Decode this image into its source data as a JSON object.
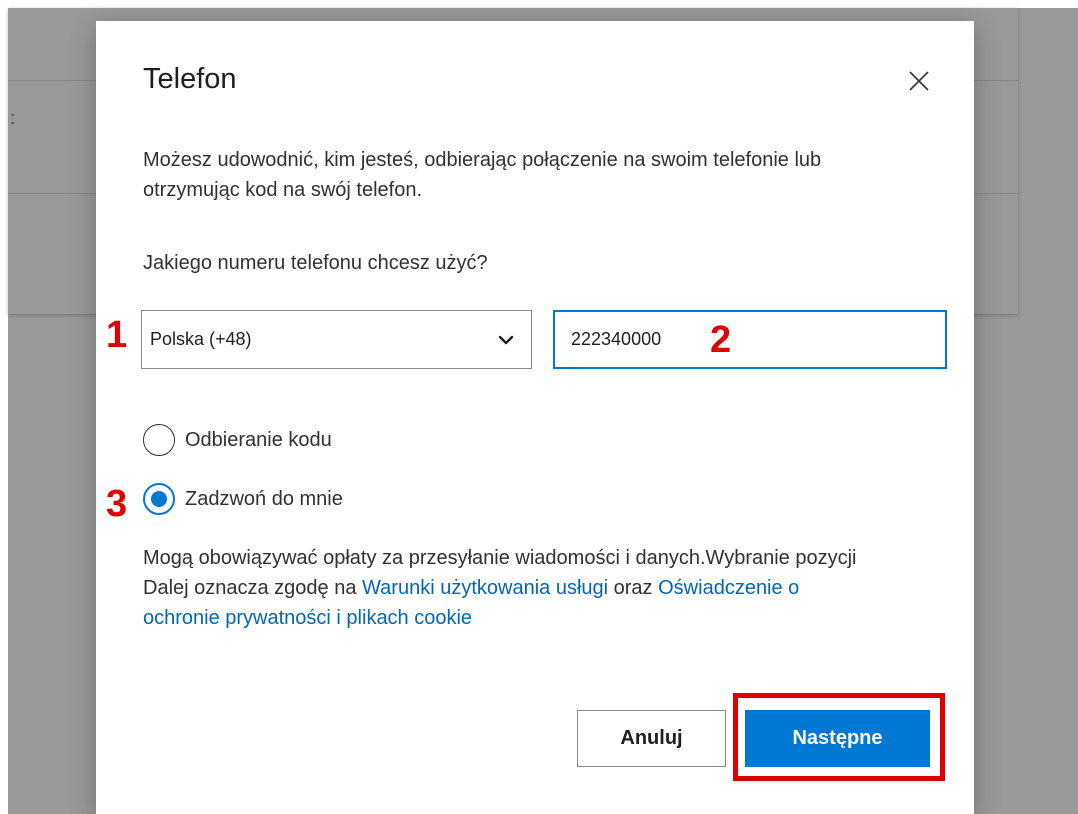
{
  "dialog": {
    "title": "Telefon",
    "description": "Możesz udowodnić, kim jesteś, odbierając połączenie na swoim telefonie lub otrzymując kod na swój telefon.",
    "question": "Jakiego numeru telefonu chcesz użyć?",
    "country_select": {
      "selected": "Polska (+48)"
    },
    "phone_input": {
      "value": "222340000"
    },
    "radio_options": [
      {
        "label": "Odbieranie kodu",
        "checked": false
      },
      {
        "label": "Zadzwoń do mnie",
        "checked": true
      }
    ],
    "legal": {
      "text_1": "Mogą obowiązywać opłaty za przesyłanie wiadomości i danych.Wybranie pozycji Dalej oznacza zgodę na ",
      "link_terms": "Warunki użytkowania usługi",
      "text_2": " oraz ",
      "link_privacy": "Oświadczenie o ochronie prywatności i plikach cookie"
    },
    "buttons": {
      "cancel": "Anuluj",
      "next": "Następne"
    }
  },
  "annotations": {
    "step_1": "1",
    "step_2": "2",
    "step_3": "3",
    "highlight_color": "#e00000"
  },
  "colors": {
    "accent": "#0078d4",
    "link": "#0067b8"
  },
  "icons": {
    "close": "close-icon",
    "dropdown": "chevron-down-icon"
  }
}
